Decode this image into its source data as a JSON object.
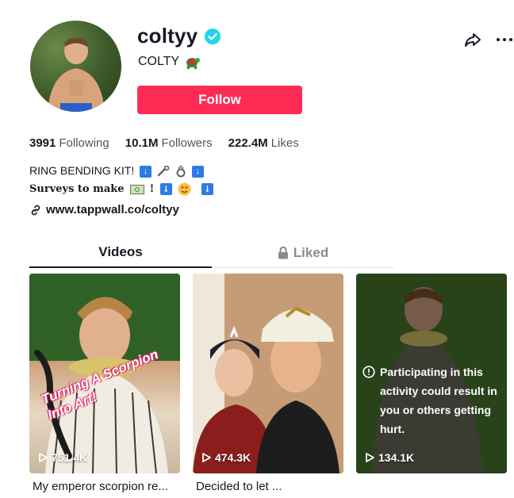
{
  "profile": {
    "username": "coltyy",
    "nickname": "COLTY",
    "follow_label": "Follow",
    "stats": [
      {
        "value": "3991",
        "label": "Following"
      },
      {
        "value": "10.1M",
        "label": "Followers"
      },
      {
        "value": "222.4M",
        "label": "Likes"
      }
    ],
    "bio_line1": "RING BENDING KIT!",
    "bio_line2": "Surveys to make",
    "link": "www.tappwall.co/coltyy"
  },
  "tabs": [
    {
      "label": "Videos",
      "active": true
    },
    {
      "label": "Liked",
      "active": false
    }
  ],
  "videos": [
    {
      "views": "751.4K",
      "caption": "My emperor scorpion re...",
      "overlay": "Turning A Scorpion Into Art!"
    },
    {
      "views": "474.3K",
      "caption": "Decided to let ..."
    },
    {
      "views": "134.1K",
      "caption": "",
      "warning": "Participating in this activity could result in you or others getting hurt."
    }
  ],
  "colors": {
    "accent": "#fe2c55",
    "verified": "#20d5ec",
    "text_primary": "#161823",
    "text_secondary": "#54565e"
  },
  "icons": [
    "verified-badge-icon",
    "share-icon",
    "more-icon",
    "link-icon",
    "lock-icon",
    "play-icon",
    "warning-icon"
  ]
}
